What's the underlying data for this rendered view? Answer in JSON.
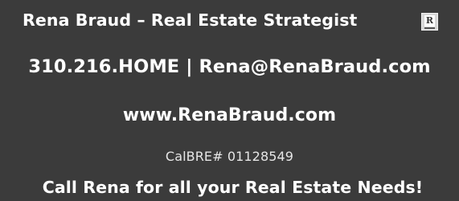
{
  "card": {
    "title": "Rena Braud – Real Estate Strategist",
    "realtor_logo_letter": "R",
    "contact": "310.216.HOME | Rena@RenaBraud.com",
    "website": "www.RenaBraud.com",
    "license": "CalBRE# 01128549",
    "call_to_action": "Call Rena for all your Real Estate Needs!"
  },
  "colors": {
    "background": "#3b3b3b",
    "text": "#ffffff"
  },
  "icons": {
    "realtor": "realtor-logo-icon"
  }
}
